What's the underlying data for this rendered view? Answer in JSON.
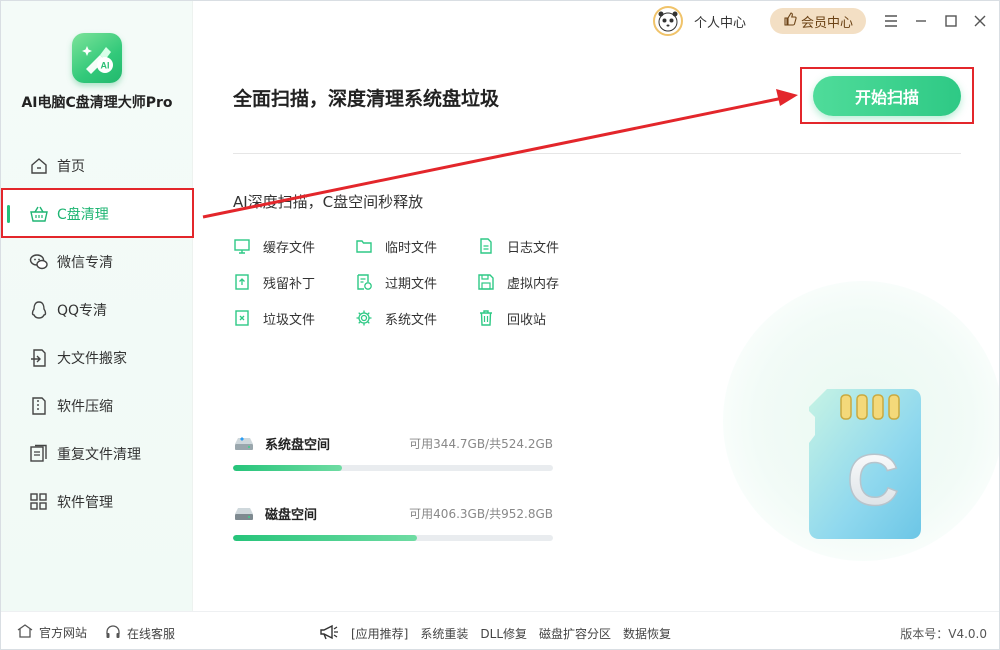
{
  "app": {
    "name": "AI电脑C盘清理大师Pro"
  },
  "titlebar": {
    "user_center": "个人中心",
    "vip_label": "会员中心"
  },
  "sidebar": {
    "items": [
      {
        "label": "首页",
        "icon": "home-icon"
      },
      {
        "label": "C盘清理",
        "icon": "basket-icon",
        "active": true
      },
      {
        "label": "微信专清",
        "icon": "wechat-icon"
      },
      {
        "label": "QQ专清",
        "icon": "qq-icon"
      },
      {
        "label": "大文件搬家",
        "icon": "move-file-icon"
      },
      {
        "label": "软件压缩",
        "icon": "zip-icon"
      },
      {
        "label": "重复文件清理",
        "icon": "duplicate-icon"
      },
      {
        "label": "软件管理",
        "icon": "apps-icon"
      }
    ]
  },
  "main": {
    "title": "全面扫描，深度清理系统盘垃圾",
    "scan_button": "开始扫描",
    "subtitle": "AI深度扫描，C盘空间秒释放",
    "features": [
      {
        "label": "缓存文件",
        "icon": "monitor-icon"
      },
      {
        "label": "临时文件",
        "icon": "folder-icon"
      },
      {
        "label": "日志文件",
        "icon": "document-icon"
      },
      {
        "label": "残留补丁",
        "icon": "patch-icon"
      },
      {
        "label": "过期文件",
        "icon": "expired-file-icon"
      },
      {
        "label": "虚拟内存",
        "icon": "save-icon"
      },
      {
        "label": "垃圾文件",
        "icon": "junk-file-icon"
      },
      {
        "label": "系统文件",
        "icon": "gear-icon"
      },
      {
        "label": "回收站",
        "icon": "trash-icon"
      }
    ],
    "disks": [
      {
        "name": "系统盘空间",
        "info": "可用344.7GB/共524.2GB",
        "used_fraction": 0.342
      },
      {
        "name": "磁盘空间",
        "info": "可用406.3GB/共952.8GB",
        "used_fraction": 0.574
      }
    ],
    "illustration": {
      "letter": "C"
    }
  },
  "footer": {
    "website": "官方网站",
    "support": "在线客服",
    "recommend": "[应用推荐]",
    "links": [
      "系统重装",
      "DLL修复",
      "磁盘扩容分区",
      "数据恢复"
    ],
    "version": "版本号：V4.0.0"
  },
  "colors": {
    "accent": "#2ec985",
    "annotation_red": "#e3262b",
    "vip_bg": "#f3dfc4"
  }
}
